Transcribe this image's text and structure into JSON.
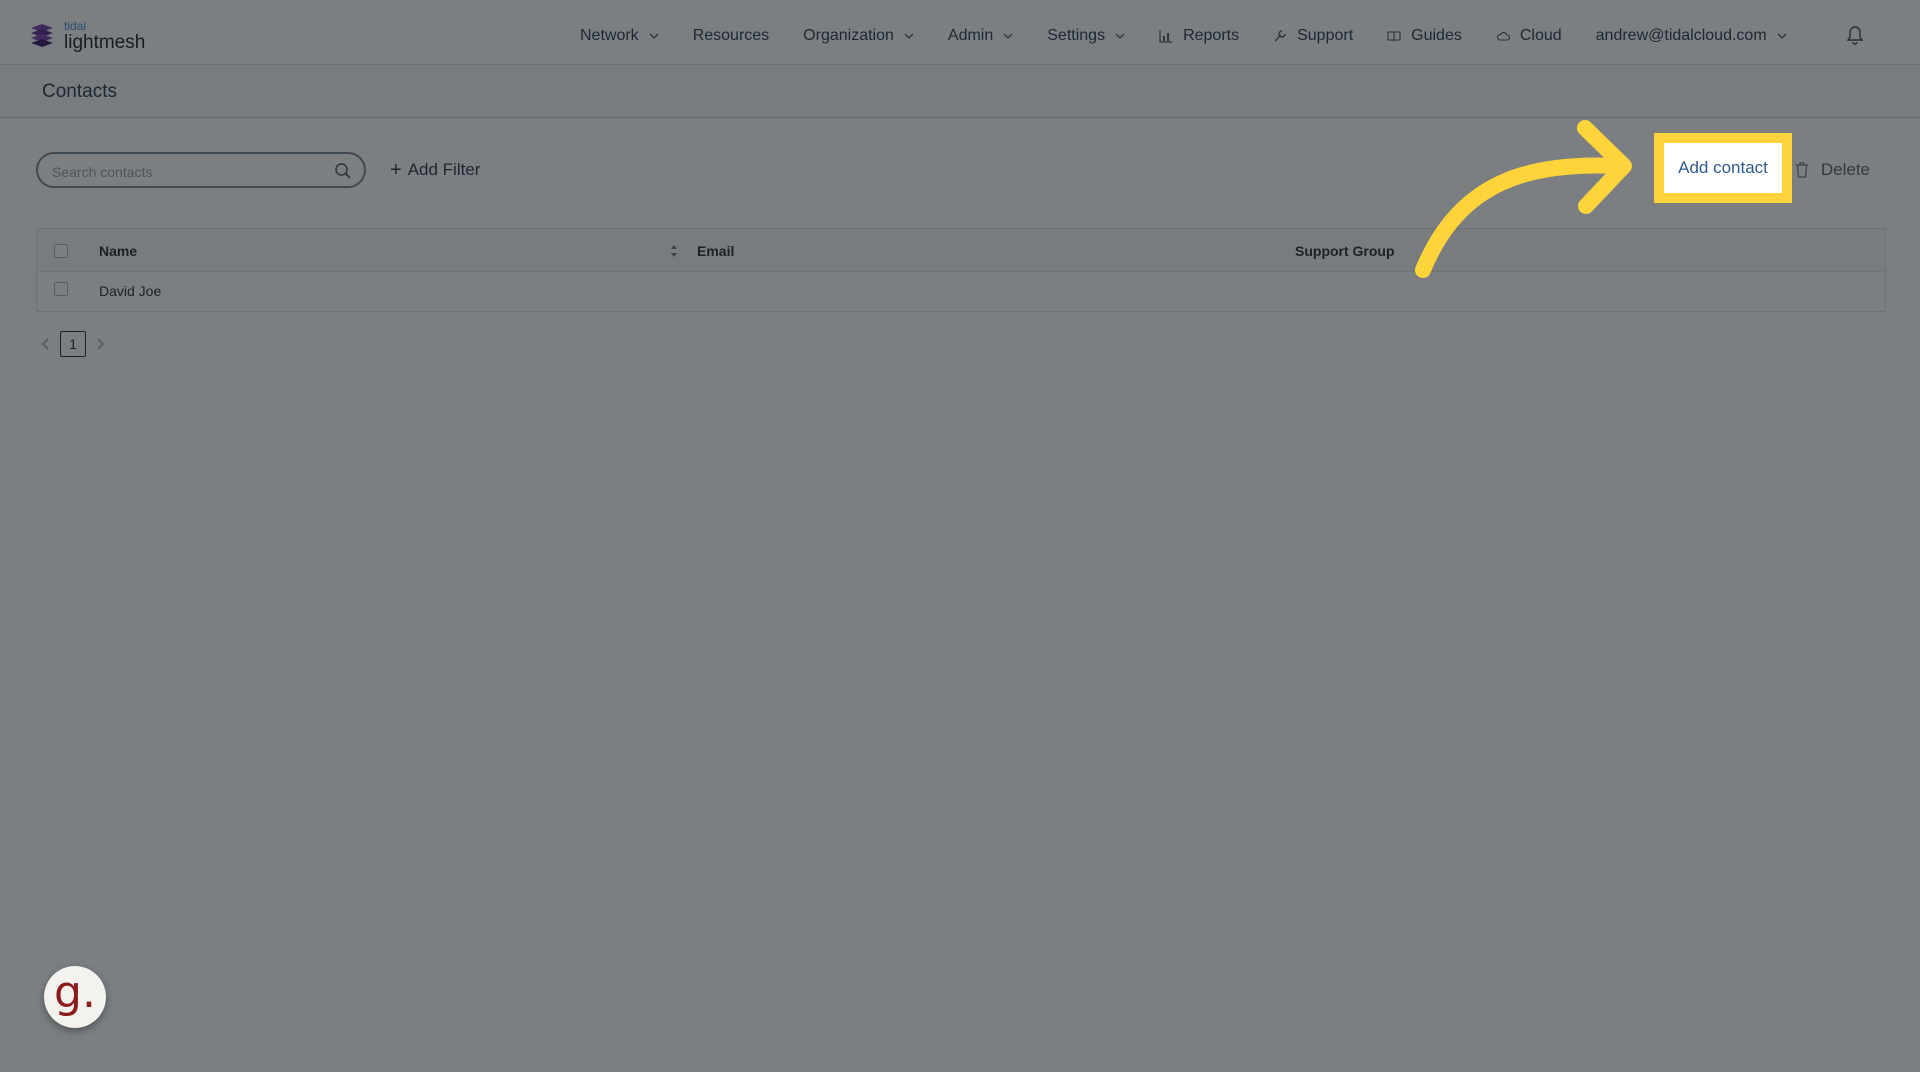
{
  "brand": {
    "small": "tidal",
    "big": "lightmesh"
  },
  "nav": {
    "items": [
      {
        "label": "Network",
        "icon": "",
        "dropdown": true
      },
      {
        "label": "Resources",
        "icon": "",
        "dropdown": false
      },
      {
        "label": "Organization",
        "icon": "",
        "dropdown": true
      },
      {
        "label": "Admin",
        "icon": "",
        "dropdown": true
      },
      {
        "label": "Settings",
        "icon": "",
        "dropdown": true
      },
      {
        "label": "Reports",
        "icon": "bar-chart-icon",
        "dropdown": false
      },
      {
        "label": "Support",
        "icon": "wrench-icon",
        "dropdown": false
      },
      {
        "label": "Guides",
        "icon": "book-icon",
        "dropdown": false
      },
      {
        "label": "Cloud",
        "icon": "cloud-icon",
        "dropdown": false
      },
      {
        "label": "andrew@tidalcloud.com",
        "icon": "",
        "dropdown": true
      }
    ]
  },
  "page": {
    "title": "Contacts"
  },
  "toolbar": {
    "search_placeholder": "Search contacts",
    "add_filter_label": "Add Filter",
    "add_contact_label": "Add contact",
    "delete_label": "Delete"
  },
  "table": {
    "columns": [
      "Name",
      "Email",
      "Support Group"
    ],
    "rows": [
      {
        "name": "David Joe",
        "email": "",
        "support_group": ""
      }
    ]
  },
  "pagination": {
    "current_page": "1"
  },
  "overlay": {
    "highlight_color": "#ffd43b",
    "dim_color": "#141a20",
    "badge_letter": "g."
  },
  "colors": {
    "accent": "#2e5a92",
    "brand_purple": "#5b2a86"
  }
}
